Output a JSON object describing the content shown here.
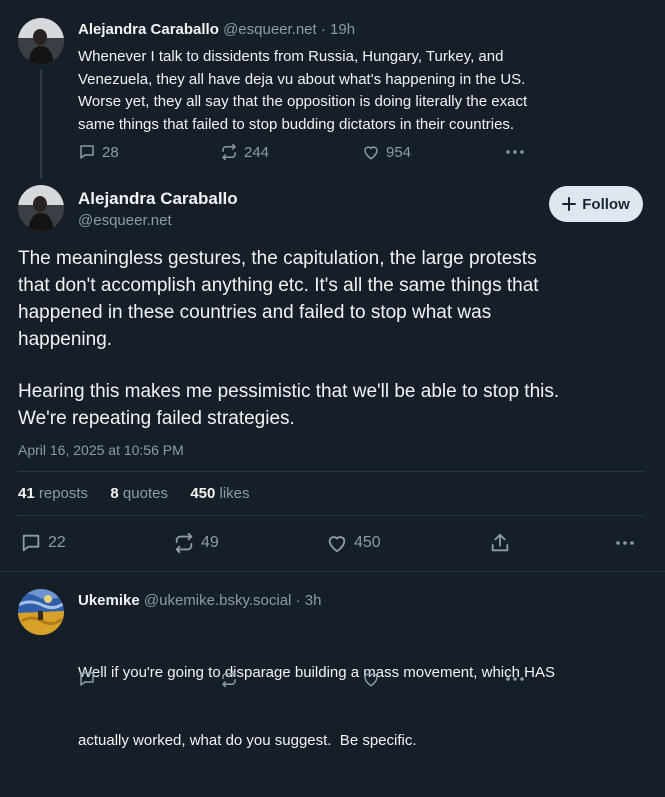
{
  "parent_post": {
    "author_name": "Alejandra Caraballo",
    "author_handle": "@esqueer.net",
    "time": "· 19h",
    "lines": [
      "Whenever I talk to dissidents from Russia, Hungary, Turkey, and",
      "Venezuela, they all have deja vu about what's happening in the US.",
      "Worse yet, they all say that the opposition is doing literally the exact",
      "same things that failed to stop budding dictators in their countries."
    ],
    "replies": "28",
    "reposts": "244",
    "likes": "954"
  },
  "main_post": {
    "author_name": "Alejandra Caraballo",
    "author_handle": "@esqueer.net",
    "follow_label": "Follow",
    "para1_lines": [
      "The meaningless gestures, the capitulation, the large protests",
      "that don't accomplish anything etc. It's all the same things that",
      "happened in these countries and failed to stop what was",
      "happening."
    ],
    "para2_lines": [
      "Hearing this makes me pessimistic that we'll be able to stop this.",
      "We're repeating failed strategies."
    ],
    "timestamp": "April 16, 2025 at 10:56 PM",
    "stats": {
      "reposts_count": "41",
      "reposts_label": "reposts",
      "quotes_count": "8",
      "quotes_label": "quotes",
      "likes_count": "450",
      "likes_label": "likes"
    },
    "replies": "22",
    "reposts": "49",
    "likes": "450"
  },
  "reply_post": {
    "author_name": "Ukemike",
    "author_handle": "@ukemike.bsky.social",
    "time": "· 3h",
    "lines": [
      "Well if you're going to disparage building a mass movement, which HAS",
      "actually worked, what do you suggest.  Be specific."
    ]
  },
  "colors": {
    "background": "#161e27",
    "text": "#f1f3f5",
    "muted": "#8d9aa9",
    "divider": "#2a3441",
    "follow_bg": "#dfe6ee"
  },
  "icons": [
    "reply-icon",
    "repost-icon",
    "like-icon",
    "share-icon",
    "more-icon",
    "plus-icon"
  ]
}
